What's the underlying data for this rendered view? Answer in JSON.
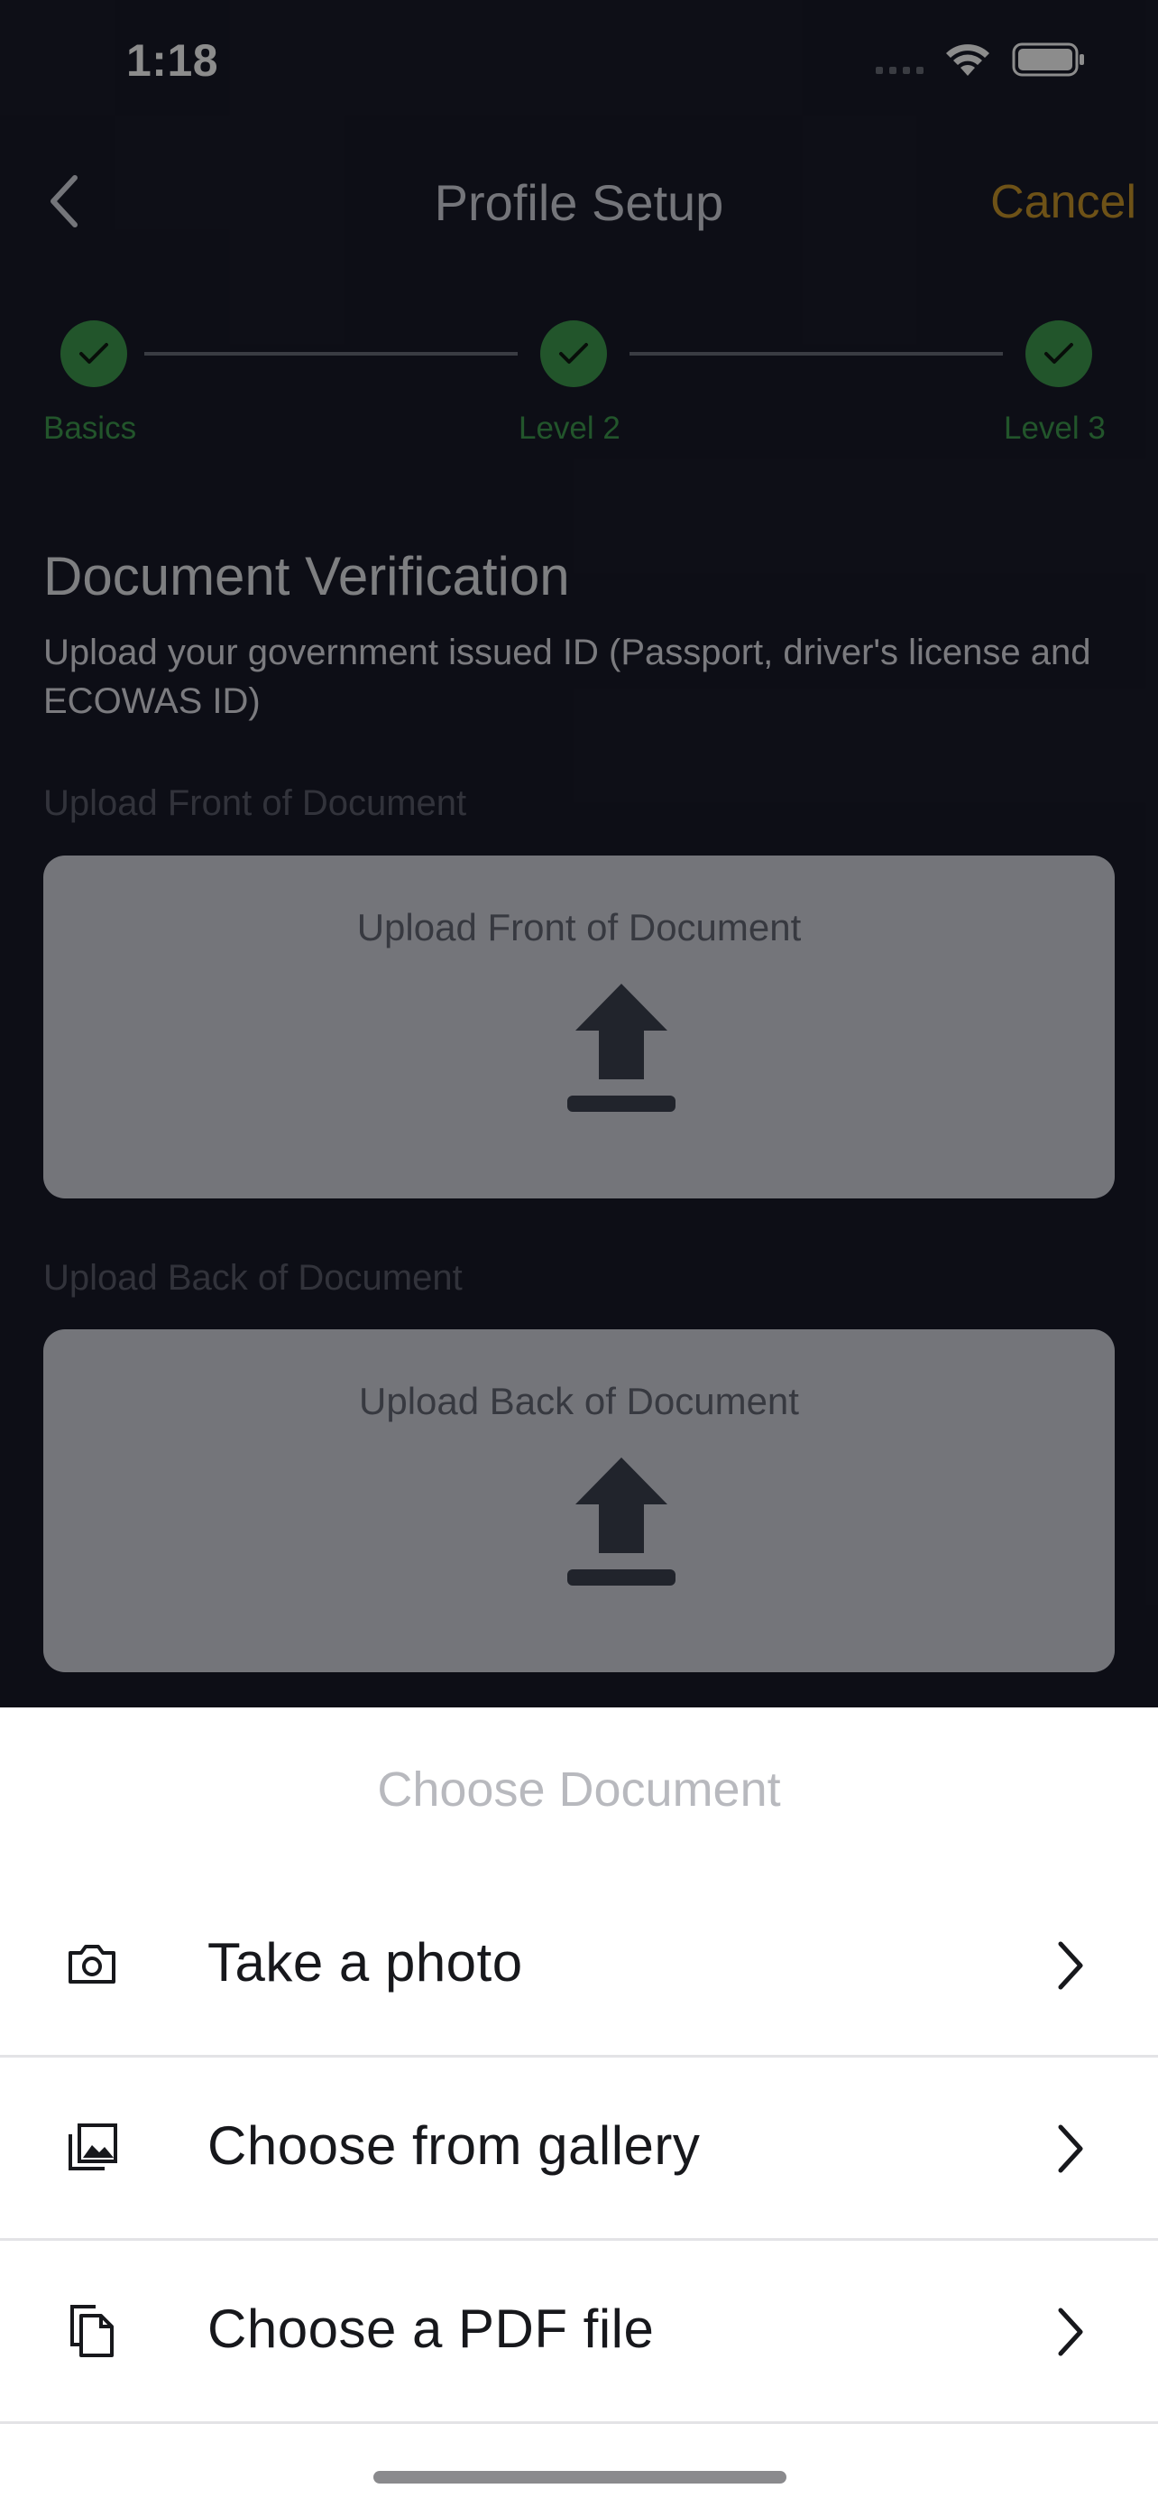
{
  "status_bar": {
    "time": "1:18"
  },
  "nav": {
    "title": "Profile Setup",
    "cancel": "Cancel",
    "back_icon": "chevron-left-icon"
  },
  "stepper": {
    "steps": [
      {
        "label": "Basics"
      },
      {
        "label": "Level 2"
      },
      {
        "label": "Level 3"
      }
    ],
    "completed_color": "#3e9b4f"
  },
  "document": {
    "title": "Document Verification",
    "description": "Upload your government issued ID (Passport, driver's license and ECOWAS ID)",
    "front": {
      "label": "Upload Front of Document",
      "box_text": "Upload Front of Document"
    },
    "back": {
      "label": "Upload Back of Document",
      "box_text": "Upload Back of Document"
    }
  },
  "sheet": {
    "title": "Choose Document",
    "options": [
      {
        "label": "Take a photo",
        "icon": "camera-icon"
      },
      {
        "label": "Choose from gallery",
        "icon": "gallery-icon"
      },
      {
        "label": "Choose a PDF file",
        "icon": "file-copy-icon"
      }
    ]
  },
  "colors": {
    "accent": "#c9962a",
    "success": "#3e9b4f",
    "background": "#191b29"
  }
}
